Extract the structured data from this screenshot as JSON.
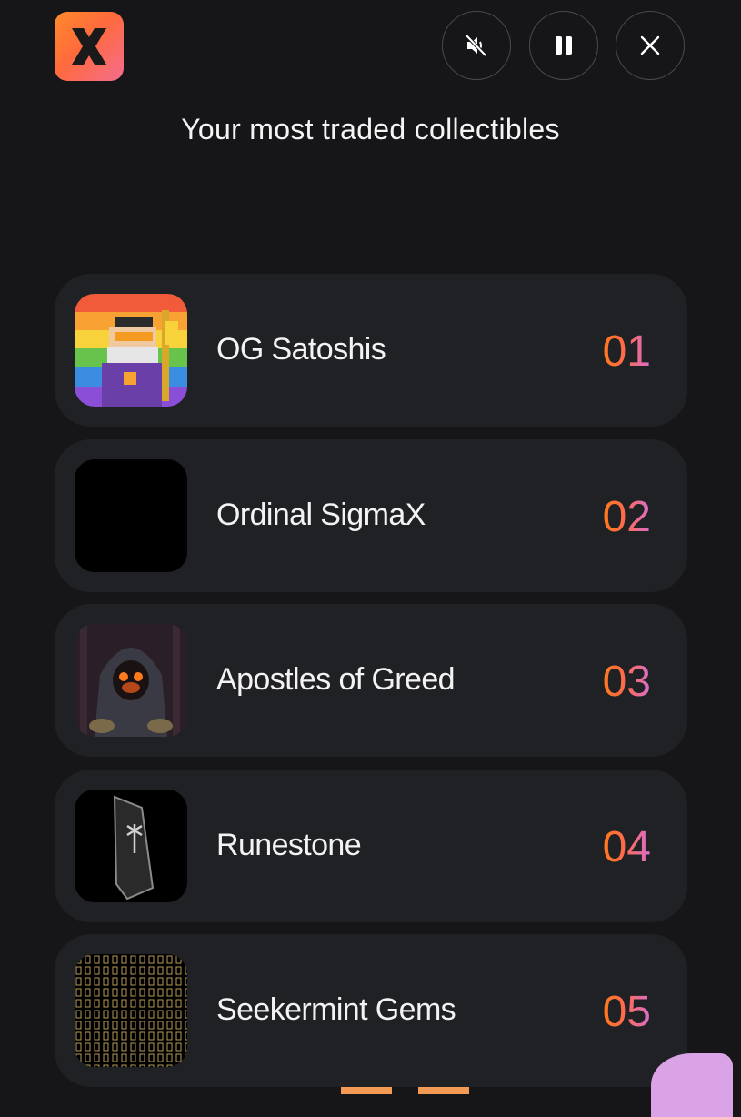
{
  "header": {
    "logo_icon": "x-logo-icon",
    "controls": [
      {
        "name": "mute-button",
        "icon": "speaker-muted-icon"
      },
      {
        "name": "pause-button",
        "icon": "pause-icon"
      },
      {
        "name": "close-button",
        "icon": "close-icon"
      }
    ]
  },
  "title": "Your most traded collectibles",
  "collections": [
    {
      "name": "OG Satoshis",
      "rank": "01",
      "thumb": "og-satoshis-thumbnail"
    },
    {
      "name": "Ordinal SigmaX",
      "rank": "02",
      "thumb": "ordinal-sigmax-thumbnail"
    },
    {
      "name": "Apostles of Greed",
      "rank": "03",
      "thumb": "apostles-of-greed-thumbnail"
    },
    {
      "name": "Runestone",
      "rank": "04",
      "thumb": "runestone-thumbnail"
    },
    {
      "name": "Seekermint Gems",
      "rank": "05",
      "thumb": "seekermint-gems-thumbnail"
    }
  ],
  "colors": {
    "background": "#161618",
    "card": "#202124",
    "rank_gradient_start": "#ff7a1a",
    "rank_gradient_end": "#d76ed0"
  }
}
